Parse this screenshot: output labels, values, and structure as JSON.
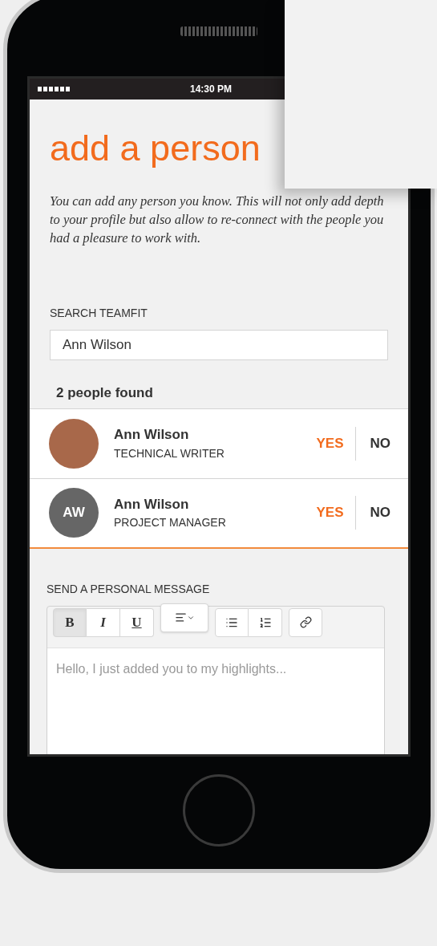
{
  "status_bar": {
    "time": "14:30 PM"
  },
  "title": "add a person",
  "description": "You can add any person you know. This will not only add depth to your profile but also allow to re-connect with the people you had a pleasure to work with.",
  "search": {
    "label": "SEARCH TEAMFIT",
    "value": "Ann Wilson"
  },
  "results_count": "2 people found",
  "people": [
    {
      "name": "Ann Wilson",
      "role": "TECHNICAL WRITER",
      "avatar": {
        "kind": "photo"
      },
      "accept": "YES",
      "decline": "NO"
    },
    {
      "name": "Ann Wilson",
      "role": "PROJECT MANAGER",
      "avatar": {
        "kind": "initials",
        "initials": "AW"
      },
      "accept": "YES",
      "decline": "NO"
    }
  ],
  "message": {
    "label": "SEND A PERSONAL MESSAGE",
    "placeholder": "Hello, I just added you to my highlights...",
    "toolbar_groups": [
      {
        "buttons": [
          {
            "kind": "bold",
            "label": "B",
            "selected": true
          },
          {
            "kind": "italic",
            "label": "I",
            "selected": false
          },
          {
            "kind": "underline",
            "label": "U",
            "selected": false
          }
        ]
      },
      {
        "buttons": [
          {
            "kind": "align",
            "selected": false
          }
        ]
      },
      {
        "buttons": [
          {
            "kind": "bullets",
            "selected": false
          },
          {
            "kind": "numbers",
            "selected": false
          }
        ]
      },
      {
        "buttons": [
          {
            "kind": "link",
            "selected": false
          }
        ]
      }
    ]
  }
}
